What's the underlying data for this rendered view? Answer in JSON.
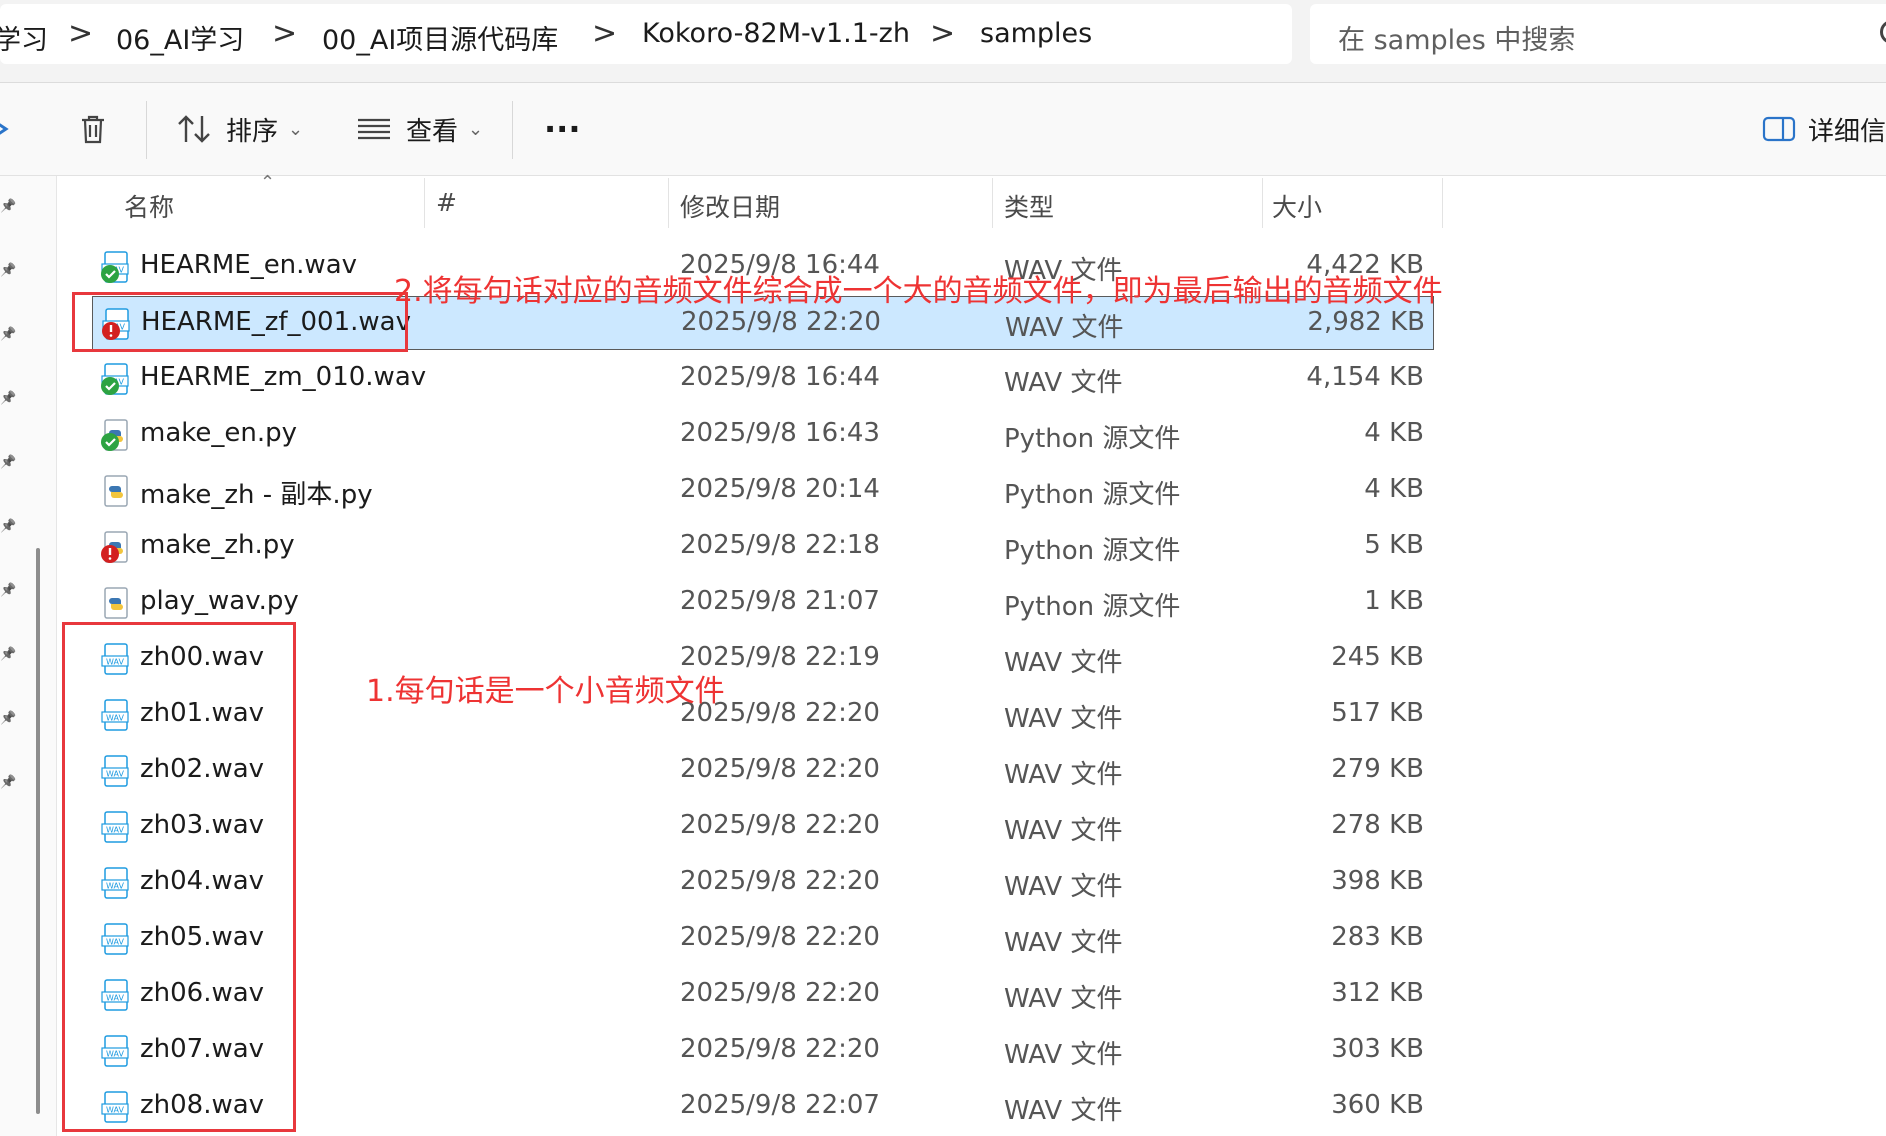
{
  "address": {
    "crumbs": [
      "学习",
      "06_AI学习",
      "00_AI项目源代码库",
      "Kokoro-82M-v1.1-zh",
      "samples"
    ],
    "separator": ">"
  },
  "search": {
    "placeholder": "在 samples 中搜索"
  },
  "toolbar": {
    "sort_label": "排序",
    "view_label": "查看",
    "more_label": "···",
    "details_label": "详细信息"
  },
  "columns": {
    "name": "名称",
    "number": "#",
    "date": "修改日期",
    "type": "类型",
    "size": "大小"
  },
  "files": [
    {
      "name": "HEARME_en.wav",
      "date": "2025/9/8 16:44",
      "type": "WAV 文件",
      "size": "4,422 KB",
      "icon": "synced-audio-icon"
    },
    {
      "name": "HEARME_zf_001.wav",
      "date": "2025/9/8 22:20",
      "type": "WAV 文件",
      "size": "2,982 KB",
      "icon": "sync-error-audio-icon"
    },
    {
      "name": "HEARME_zm_010.wav",
      "date": "2025/9/8 16:44",
      "type": "WAV 文件",
      "size": "4,154 KB",
      "icon": "synced-audio-icon"
    },
    {
      "name": "make_en.py",
      "date": "2025/9/8 16:43",
      "type": "Python 源文件",
      "size": "4 KB",
      "icon": "synced-python-icon"
    },
    {
      "name": "make_zh - 副本.py",
      "date": "2025/9/8 20:14",
      "type": "Python 源文件",
      "size": "4 KB",
      "icon": "python-file-icon"
    },
    {
      "name": "make_zh.py",
      "date": "2025/9/8 22:18",
      "type": "Python 源文件",
      "size": "5 KB",
      "icon": "sync-error-python-icon"
    },
    {
      "name": "play_wav.py",
      "date": "2025/9/8 21:07",
      "type": "Python 源文件",
      "size": "1 KB",
      "icon": "python-file-icon"
    },
    {
      "name": "zh00.wav",
      "date": "2025/9/8 22:19",
      "type": "WAV 文件",
      "size": "245 KB",
      "icon": "wav-file-icon"
    },
    {
      "name": "zh01.wav",
      "date": "2025/9/8 22:20",
      "type": "WAV 文件",
      "size": "517 KB",
      "icon": "wav-file-icon"
    },
    {
      "name": "zh02.wav",
      "date": "2025/9/8 22:20",
      "type": "WAV 文件",
      "size": "279 KB",
      "icon": "wav-file-icon"
    },
    {
      "name": "zh03.wav",
      "date": "2025/9/8 22:20",
      "type": "WAV 文件",
      "size": "278 KB",
      "icon": "wav-file-icon"
    },
    {
      "name": "zh04.wav",
      "date": "2025/9/8 22:20",
      "type": "WAV 文件",
      "size": "398 KB",
      "icon": "wav-file-icon"
    },
    {
      "name": "zh05.wav",
      "date": "2025/9/8 22:20",
      "type": "WAV 文件",
      "size": "283 KB",
      "icon": "wav-file-icon"
    },
    {
      "name": "zh06.wav",
      "date": "2025/9/8 22:20",
      "type": "WAV 文件",
      "size": "312 KB",
      "icon": "wav-file-icon"
    },
    {
      "name": "zh07.wav",
      "date": "2025/9/8 22:20",
      "type": "WAV 文件",
      "size": "303 KB",
      "icon": "wav-file-icon"
    },
    {
      "name": "zh08.wav",
      "date": "2025/9/8 22:07",
      "type": "WAV 文件",
      "size": "360 KB",
      "icon": "wav-file-icon"
    }
  ],
  "annotations": {
    "note_merge": "2.将每句话对应的音频文件综合成一个大的音频文件，即为最后输出的音频文件",
    "note_sentences": "1.每句话是一个小音频文件"
  },
  "colors": {
    "selected_row": "#cce8ff",
    "annotation_red": "#ee3333",
    "wav_icon": "#1f9be0",
    "ok_green": "#2da342",
    "err_red": "#d32020"
  }
}
